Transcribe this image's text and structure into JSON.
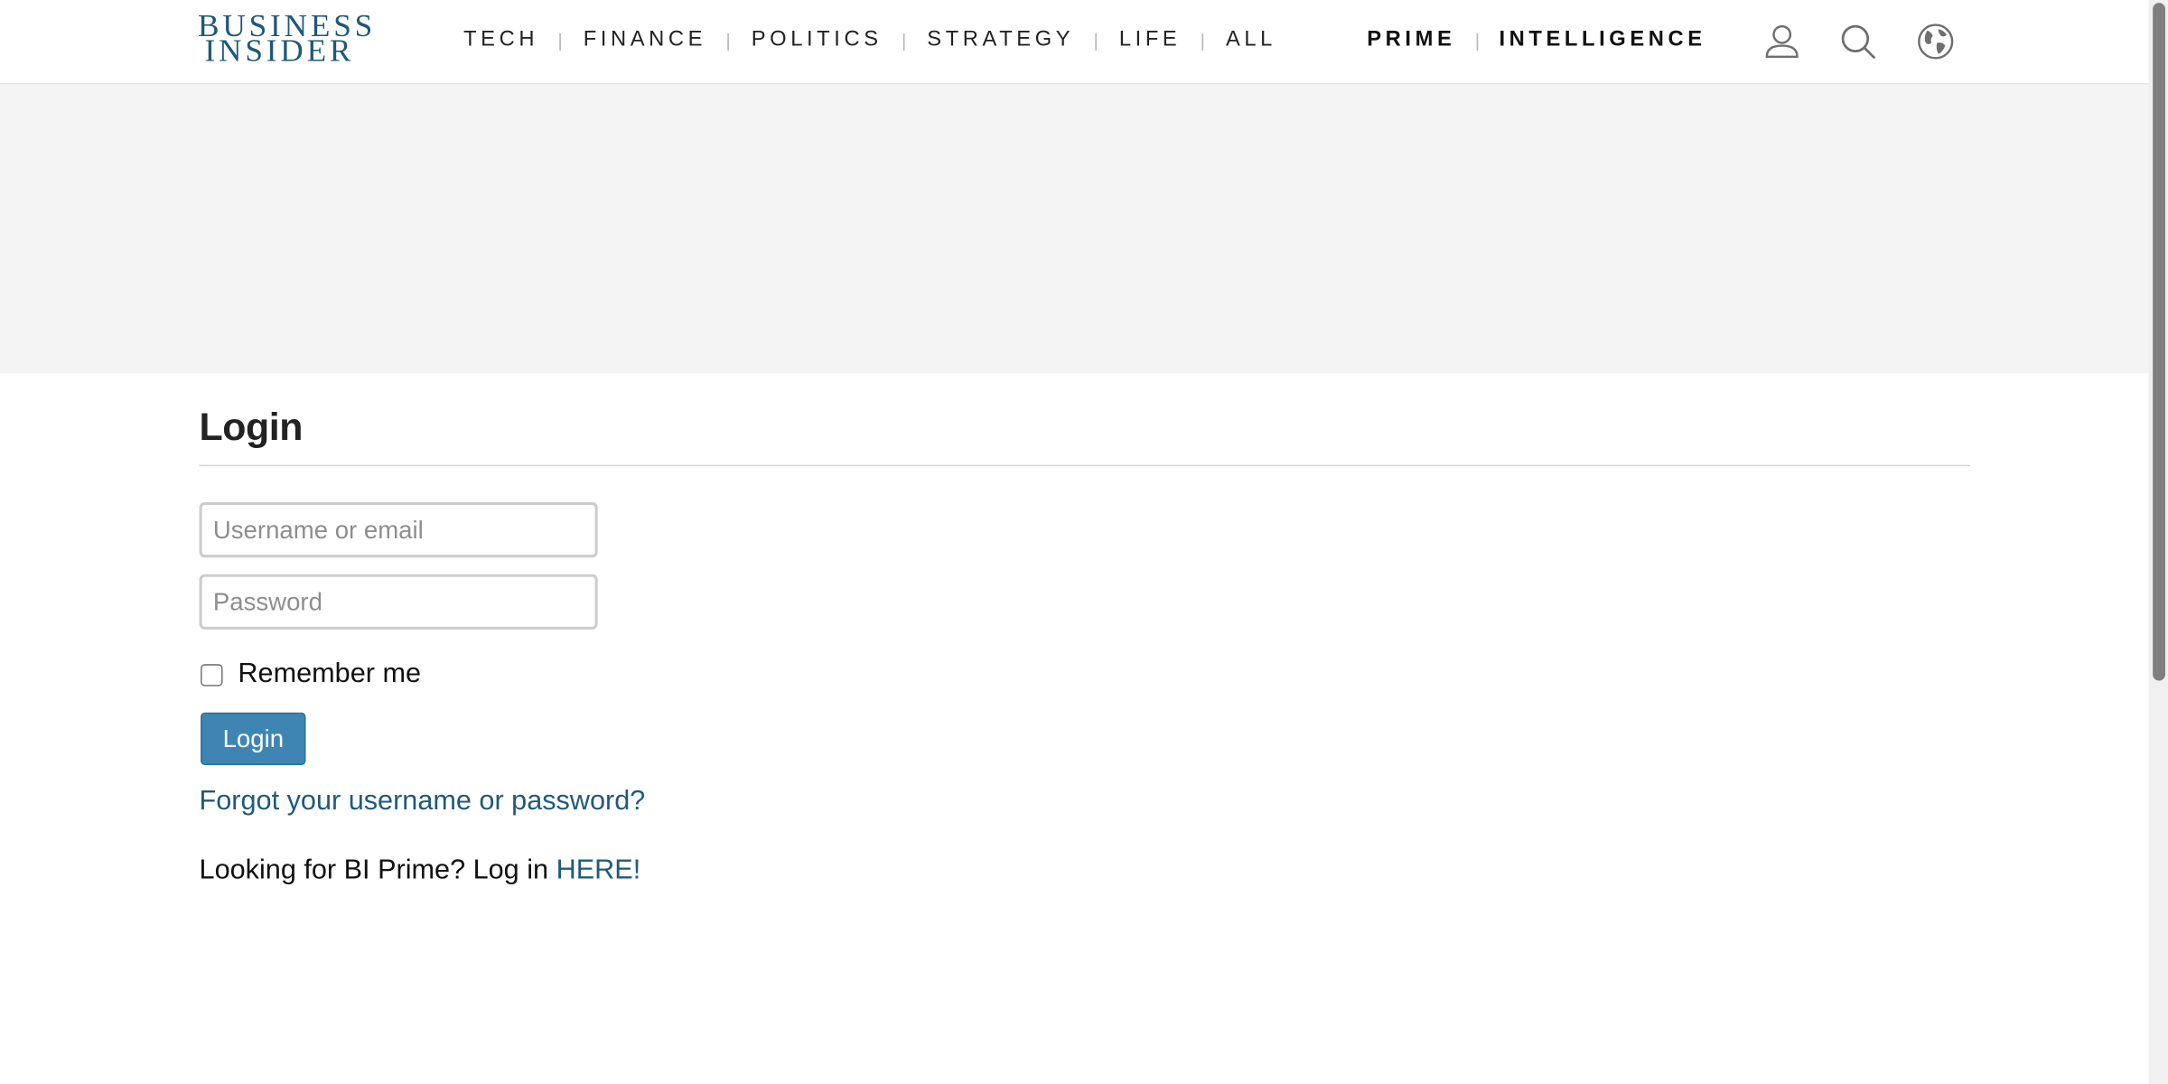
{
  "header": {
    "logo_line1": "BUSINESS",
    "logo_line2": "INSIDER",
    "nav": [
      "TECH",
      "FINANCE",
      "POLITICS",
      "STRATEGY",
      "LIFE",
      "ALL"
    ],
    "nav_right": [
      "PRIME",
      "INTELLIGENCE"
    ],
    "icons": [
      "user-icon",
      "search-icon",
      "globe-icon"
    ]
  },
  "login": {
    "title": "Login",
    "username_placeholder": "Username or email",
    "password_placeholder": "Password",
    "remember_label": "Remember me",
    "remember_checked": false,
    "submit_label": "Login",
    "forgot_link": "Forgot your username or password?",
    "prime_text": "Looking for BI Prime? Log in ",
    "prime_link": "HERE!"
  },
  "colors": {
    "brand": "#1f5877",
    "button": "#3f85b4",
    "link": "#1f5a7c",
    "ad_band": "#f4f4f4"
  }
}
